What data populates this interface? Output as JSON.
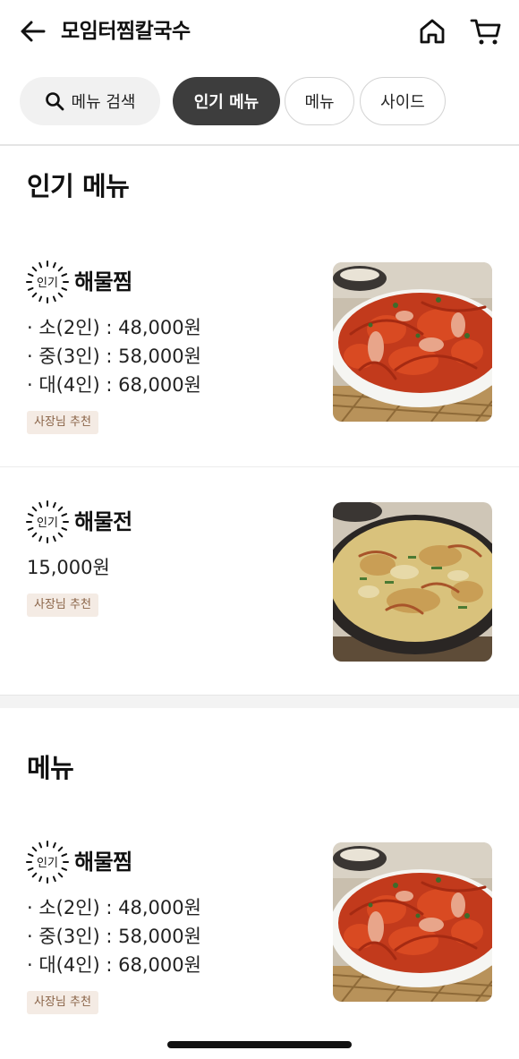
{
  "header": {
    "title": "모임터찜칼국수",
    "back_icon": "arrow-left-icon",
    "home_icon": "home-icon",
    "cart_icon": "cart-icon"
  },
  "chips": {
    "search_label": "메뉴 검색",
    "search_icon": "search-icon",
    "popular_label": "인기 메뉴",
    "menu_label": "메뉴",
    "side_label": "사이드"
  },
  "sections": [
    {
      "title": "인기 메뉴",
      "items": [
        {
          "badge": "인기",
          "name": "해물찜",
          "prices": [
            "· 소(2인) : 48,000원",
            "· 중(3인) : 58,000원",
            "· 대(4인) : 68,000원"
          ],
          "tag": "사장님 추천"
        },
        {
          "badge": "인기",
          "name": "해물전",
          "prices": [
            "15,000원"
          ],
          "tag": "사장님 추천"
        }
      ]
    },
    {
      "title": "메뉴",
      "items": [
        {
          "badge": "인기",
          "name": "해물찜",
          "prices": [
            "· 소(2인) : 48,000원",
            "· 중(3인) : 58,000원",
            "· 대(4인) : 68,000원"
          ],
          "tag": "사장님 추천"
        }
      ]
    }
  ],
  "colors": {
    "active_chip": "#3d3d3d",
    "tag_bg": "#f4ebe4",
    "tag_text": "#8a6448"
  }
}
